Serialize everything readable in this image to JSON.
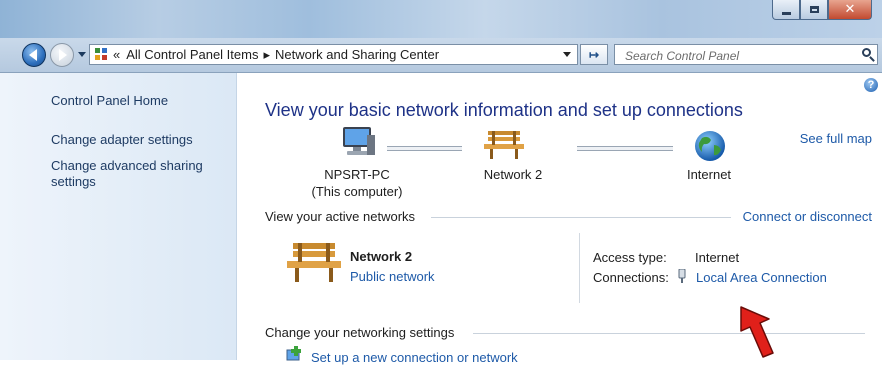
{
  "window": {
    "controls": {
      "minimize": "minimize",
      "maximize": "maximize",
      "close": "close"
    }
  },
  "navigation": {
    "address": {
      "overflow": "«",
      "crumbs": [
        "All Control Panel Items",
        "Network and Sharing Center"
      ],
      "separator": "▸"
    },
    "refresh_icon": "refresh-icon",
    "search": {
      "placeholder": "Search Control Panel"
    }
  },
  "sidebar": {
    "home": "Control Panel Home",
    "items": [
      "Change adapter settings",
      "Change advanced sharing settings"
    ]
  },
  "main": {
    "help": "?",
    "title": "View your basic network information and set up connections",
    "see_full_map": "See full map",
    "map": {
      "computer": {
        "name": "NPSRT-PC",
        "sub": "(This computer)"
      },
      "network": {
        "name": "Network  2"
      },
      "internet": {
        "name": "Internet"
      }
    },
    "active_networks": {
      "heading": "View your active networks",
      "connect_link": "Connect or disconnect",
      "network_name": "Network  2",
      "network_category": "Public network",
      "access_type_label": "Access type:",
      "access_type_value": "Internet",
      "connections_label": "Connections:",
      "connections_value": "Local Area Connection"
    },
    "settings": {
      "heading": "Change your networking settings",
      "setup_item": "Set up a new connection or network"
    }
  },
  "colors": {
    "link": "#1e5aa8",
    "title": "#1e3287",
    "arrow": "#e0201a"
  }
}
